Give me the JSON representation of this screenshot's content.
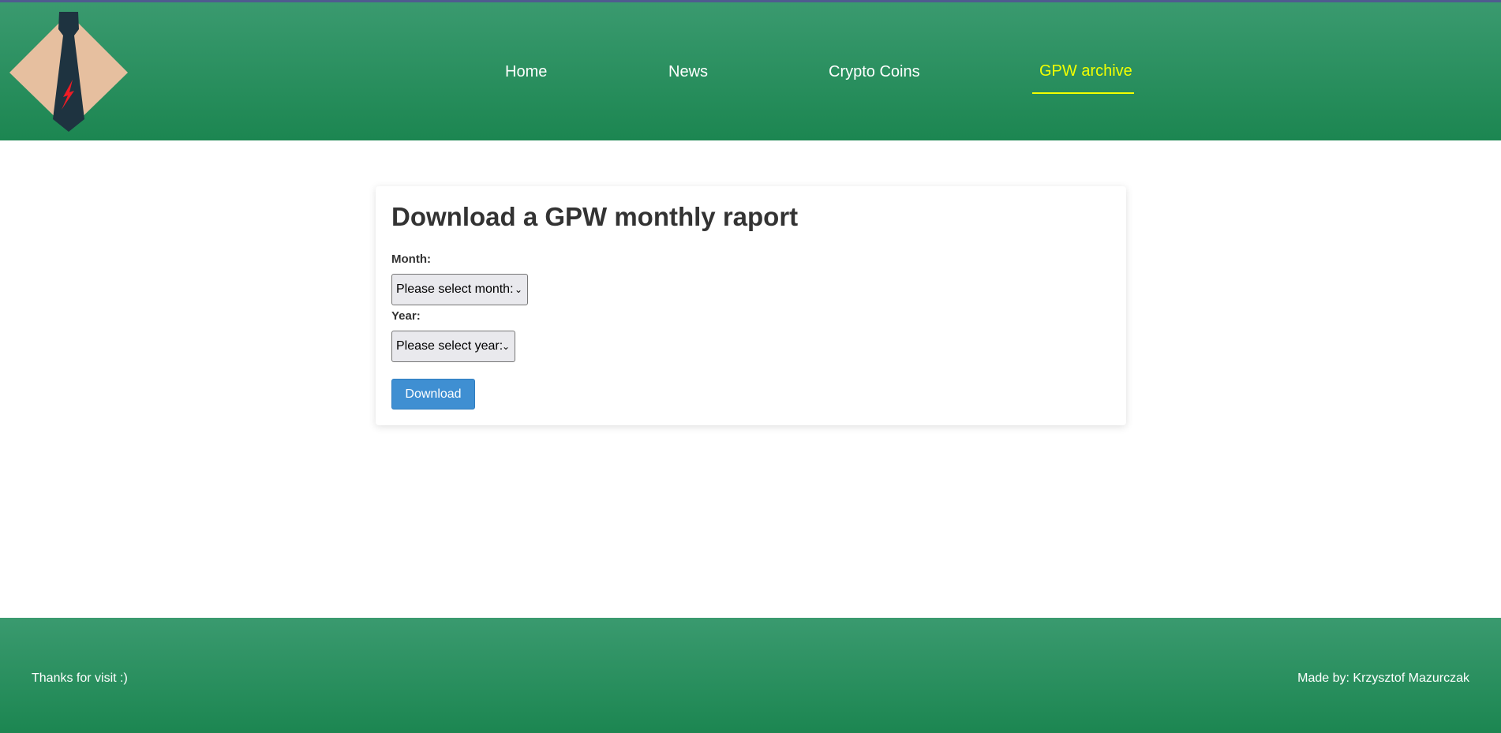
{
  "brand": {
    "logo_icon": "tie-logo-icon"
  },
  "nav": {
    "items": [
      {
        "label": "Home"
      },
      {
        "label": "News"
      },
      {
        "label": "Crypto Coins"
      },
      {
        "label": "GPW archive",
        "active": true
      }
    ]
  },
  "form": {
    "title": "Download a GPW monthly raport",
    "month_label": "Month:",
    "month_select": "Please select month:",
    "year_label": "Year:",
    "year_select": "Please select year:",
    "download_label": "Download"
  },
  "footer": {
    "left": "Thanks for visit :)",
    "right": "Made by: Krzysztof Mazurczak"
  },
  "colors": {
    "header_green": "#2a8f5e",
    "active_nav": "#f2ff00",
    "button_blue": "#3f8fd2"
  }
}
